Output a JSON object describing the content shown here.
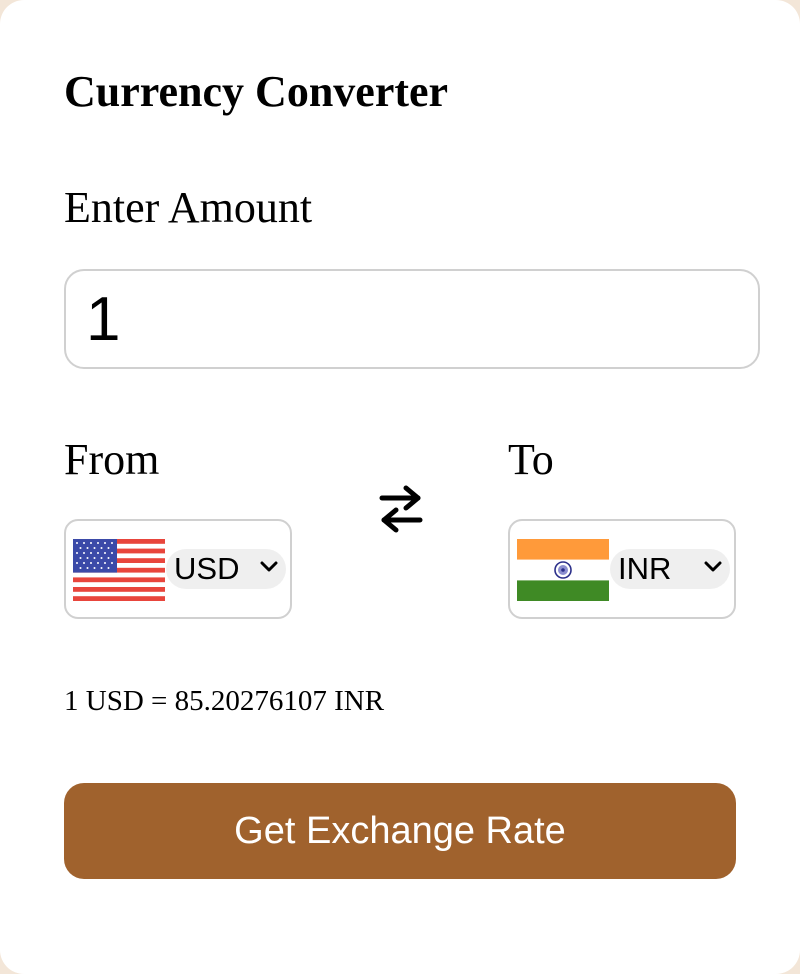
{
  "app": {
    "title": "Currency Converter"
  },
  "amount": {
    "label": "Enter Amount",
    "value": "1"
  },
  "from": {
    "label": "From",
    "currency": "USD",
    "flag": "us-flag-icon"
  },
  "to": {
    "label": "To",
    "currency": "INR",
    "flag": "india-flag-icon"
  },
  "swap": {
    "icon": "swap-arrows-icon"
  },
  "result": {
    "text": "1 USD = 85.20276107 INR"
  },
  "button": {
    "label": "Get Exchange Rate"
  },
  "colors": {
    "accent": "#a0622d",
    "background": "#f3e6d8",
    "card": "#ffffff"
  }
}
